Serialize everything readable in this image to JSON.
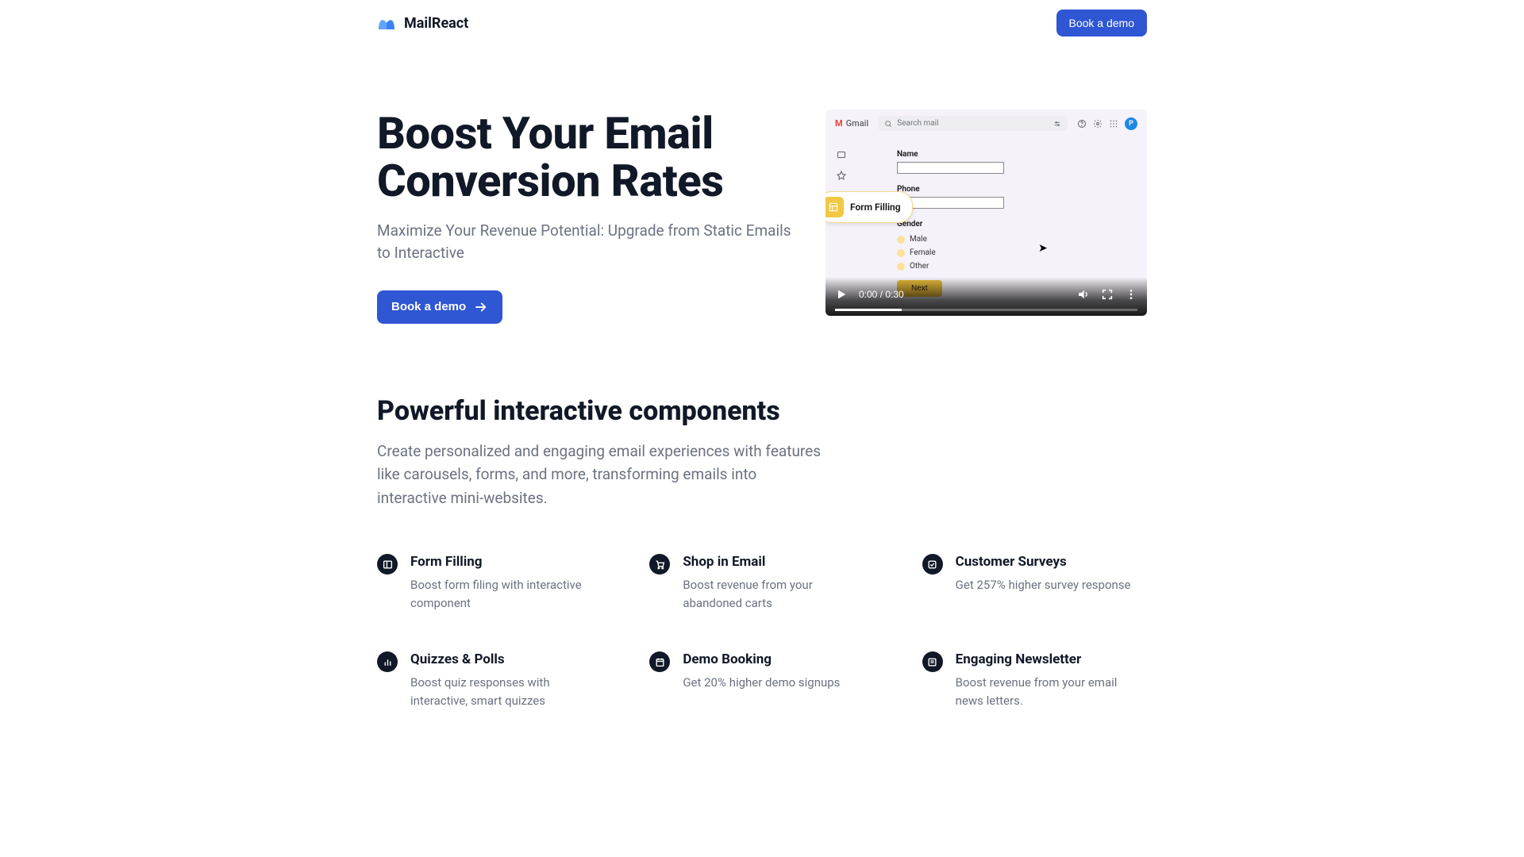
{
  "nav": {
    "brand": "MailReact",
    "cta": "Book a demo"
  },
  "hero": {
    "title": "Boost Your Email Conversion Rates",
    "subtitle": "Maximize Your Revenue Potential: Upgrade from Static Emails to Interactive",
    "cta": "Book a demo"
  },
  "video": {
    "gmail_label": "Gmail",
    "search_placeholder": "Search mail",
    "avatar_letter": "P",
    "chip_label": "Form Filling",
    "field_name": "Name",
    "field_phone": "Phone",
    "field_gender": "Gender",
    "opt_male": "Male",
    "opt_female": "Female",
    "opt_other": "Other",
    "btn_next": "Next",
    "time": "0:00 / 0:30"
  },
  "section": {
    "title": "Powerful interactive components",
    "subtitle": "Create personalized and engaging email experiences with features like carousels, forms, and more, transforming emails into interactive mini-websites."
  },
  "features": {
    "f1": {
      "title": "Form Filling",
      "desc": "Boost form filing with interactive component"
    },
    "f2": {
      "title": "Shop in Email",
      "desc": "Boost revenue from your abandoned carts"
    },
    "f3": {
      "title": "Customer Surveys",
      "desc": "Get 257% higher survey response"
    },
    "f4": {
      "title": "Quizzes & Polls",
      "desc": "Boost quiz responses with interactive, smart quizzes"
    },
    "f5": {
      "title": "Demo Booking",
      "desc": "Get 20% higher demo signups"
    },
    "f6": {
      "title": "Engaging Newsletter",
      "desc": "Boost revenue from your email news letters."
    }
  }
}
